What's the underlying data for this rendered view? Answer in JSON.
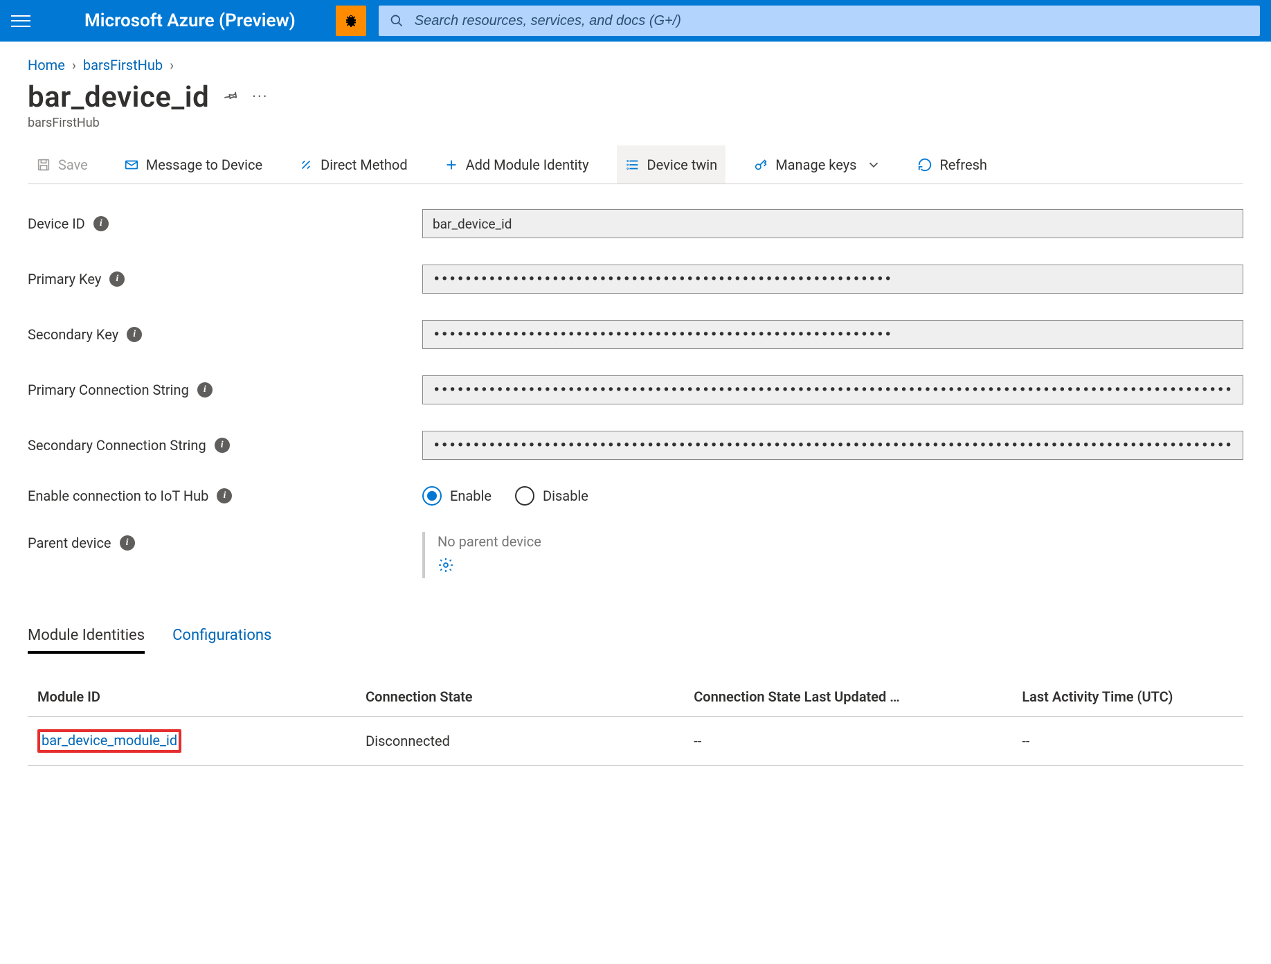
{
  "header": {
    "brand": "Microsoft Azure (Preview)",
    "search_placeholder": "Search resources, services, and docs (G+/)"
  },
  "breadcrumb": {
    "items": [
      "Home",
      "barsFirstHub"
    ]
  },
  "page": {
    "title": "bar_device_id",
    "subtitle": "barsFirstHub"
  },
  "toolbar": {
    "save": "Save",
    "message": "Message to Device",
    "direct_method": "Direct Method",
    "add_module": "Add Module Identity",
    "device_twin": "Device twin",
    "manage_keys": "Manage keys",
    "refresh": "Refresh"
  },
  "form": {
    "device_id_label": "Device ID",
    "device_id_value": "bar_device_id",
    "primary_key_label": "Primary Key",
    "primary_key_value": "••••••••••••••••••••••••••••••••••••••••••••••••••••••••••",
    "secondary_key_label": "Secondary Key",
    "secondary_key_value": "••••••••••••••••••••••••••••••••••••••••••••••••••••••••••",
    "primary_conn_label": "Primary Connection String",
    "primary_conn_value": "••••••••••••••••••••••••••••••••••••••••••••••••••••••••••••••••••••••••••••••••••••••••••••••••••••••••••••••••••••••••••••••••••••••••••••••••••••••••••••••••••",
    "secondary_conn_label": "Secondary Connection String",
    "secondary_conn_value": "••••••••••••••••••••••••••••••••••••••••••••••••••••••••••••••••••••••••••••••••••••••••••••••••••••••••••••••••••••••••••••••••••••••••••••••••••••••••••••••••••",
    "enable_conn_label": "Enable connection to IoT Hub",
    "enable_label": "Enable",
    "disable_label": "Disable",
    "parent_device_label": "Parent device",
    "no_parent": "No parent device"
  },
  "tabs": {
    "module_identities": "Module Identities",
    "configurations": "Configurations"
  },
  "table": {
    "cols": {
      "module_id": "Module ID",
      "conn_state": "Connection State",
      "conn_state_updated": "Connection State Last Updated …",
      "last_activity": "Last Activity Time (UTC)"
    },
    "rows": [
      {
        "module_id": "bar_device_module_id",
        "conn_state": "Disconnected",
        "conn_state_updated": "--",
        "last_activity": "--"
      }
    ]
  }
}
